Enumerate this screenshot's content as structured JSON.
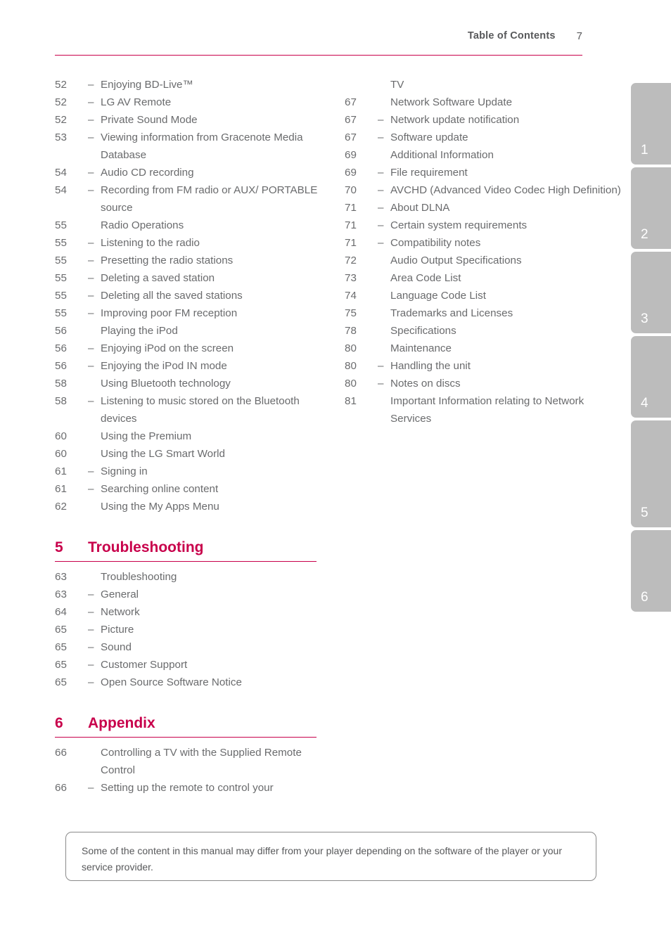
{
  "header": {
    "title": "Table of Contents",
    "page_number": "7"
  },
  "left_column": {
    "entries": [
      {
        "num": "52",
        "dash": "–",
        "text": "Enjoying BD-Live™"
      },
      {
        "num": "52",
        "dash": "–",
        "text": "LG AV Remote"
      },
      {
        "num": "52",
        "dash": "–",
        "text": "Private Sound Mode"
      },
      {
        "num": "53",
        "dash": "–",
        "text": "Viewing information from Gracenote Media Database"
      },
      {
        "num": "54",
        "dash": "–",
        "text": "Audio CD recording"
      },
      {
        "num": "54",
        "dash": "–",
        "text": "Recording from FM radio or AUX/ PORTABLE source"
      },
      {
        "num": "55",
        "dash": "",
        "text": "Radio Operations"
      },
      {
        "num": "55",
        "dash": "–",
        "text": "Listening to the radio"
      },
      {
        "num": "55",
        "dash": "–",
        "text": "Presetting the radio stations"
      },
      {
        "num": "55",
        "dash": "–",
        "text": "Deleting a saved station"
      },
      {
        "num": "55",
        "dash": "–",
        "text": "Deleting all the saved stations"
      },
      {
        "num": "55",
        "dash": "–",
        "text": "Improving poor FM reception"
      },
      {
        "num": "56",
        "dash": "",
        "text": "Playing the iPod"
      },
      {
        "num": "56",
        "dash": "–",
        "text": "Enjoying iPod on the screen"
      },
      {
        "num": "56",
        "dash": "–",
        "text": "Enjoying the iPod IN mode"
      },
      {
        "num": "58",
        "dash": "",
        "text": "Using Bluetooth technology"
      },
      {
        "num": "58",
        "dash": "–",
        "text": "Listening to music stored on the Bluetooth devices"
      },
      {
        "num": "60",
        "dash": "",
        "text": "Using the Premium"
      },
      {
        "num": "60",
        "dash": "",
        "text": "Using the LG Smart World"
      },
      {
        "num": "61",
        "dash": "–",
        "text": "Signing in"
      },
      {
        "num": "61",
        "dash": "–",
        "text": "Searching online content"
      },
      {
        "num": "62",
        "dash": "",
        "text": "Using the My Apps Menu"
      }
    ],
    "chapters": [
      {
        "num": "5",
        "title": "Troubleshooting",
        "entries": [
          {
            "num": "63",
            "dash": "",
            "text": "Troubleshooting"
          },
          {
            "num": "63",
            "dash": "–",
            "text": "General"
          },
          {
            "num": "64",
            "dash": "–",
            "text": "Network"
          },
          {
            "num": "65",
            "dash": "–",
            "text": "Picture"
          },
          {
            "num": "65",
            "dash": "–",
            "text": "Sound"
          },
          {
            "num": "65",
            "dash": "–",
            "text": "Customer Support"
          },
          {
            "num": "65",
            "dash": "–",
            "text": "Open Source Software Notice"
          }
        ]
      },
      {
        "num": "6",
        "title": "Appendix",
        "entries": [
          {
            "num": "66",
            "dash": "",
            "text": "Controlling a TV with the Supplied Remote Control"
          },
          {
            "num": "66",
            "dash": "–",
            "text": "Setting up the remote to control your"
          }
        ]
      }
    ]
  },
  "right_column": {
    "entries": [
      {
        "num": "",
        "dash": "",
        "text": "TV"
      },
      {
        "num": "67",
        "dash": "",
        "text": "Network Software Update"
      },
      {
        "num": "67",
        "dash": "–",
        "text": "Network update notification"
      },
      {
        "num": "67",
        "dash": "–",
        "text": "Software update"
      },
      {
        "num": "69",
        "dash": "",
        "text": "Additional Information"
      },
      {
        "num": "69",
        "dash": "–",
        "text": "File requirement"
      },
      {
        "num": "70",
        "dash": "–",
        "text": "AVCHD (Advanced Video Codec High Definition)"
      },
      {
        "num": "71",
        "dash": "–",
        "text": "About DLNA"
      },
      {
        "num": "71",
        "dash": "–",
        "text": "Certain system requirements"
      },
      {
        "num": "71",
        "dash": "–",
        "text": "Compatibility notes"
      },
      {
        "num": "72",
        "dash": "",
        "text": "Audio Output Specifications"
      },
      {
        "num": "73",
        "dash": "",
        "text": "Area Code List"
      },
      {
        "num": "74",
        "dash": "",
        "text": "Language Code List"
      },
      {
        "num": "75",
        "dash": "",
        "text": "Trademarks and Licenses"
      },
      {
        "num": "78",
        "dash": "",
        "text": "Specifications"
      },
      {
        "num": "80",
        "dash": "",
        "text": "Maintenance"
      },
      {
        "num": "80",
        "dash": "–",
        "text": "Handling the unit"
      },
      {
        "num": "80",
        "dash": "–",
        "text": "Notes on discs"
      },
      {
        "num": "81",
        "dash": "",
        "text": "Important Information relating to Network Services"
      }
    ]
  },
  "note": {
    "text": "Some of the content in this manual may differ from your player depending on the software of the player or your service provider."
  },
  "side_tabs": [
    {
      "label": "1"
    },
    {
      "label": "2"
    },
    {
      "label": "3"
    },
    {
      "label": "4"
    },
    {
      "label": "5"
    },
    {
      "label": "6"
    }
  ],
  "colors": {
    "accent": "#c8004b",
    "text": "#6a6b6d",
    "tab_background": "#bcbcbc",
    "tab_label": "#ffffff",
    "note_border": "#8a8a8a"
  }
}
